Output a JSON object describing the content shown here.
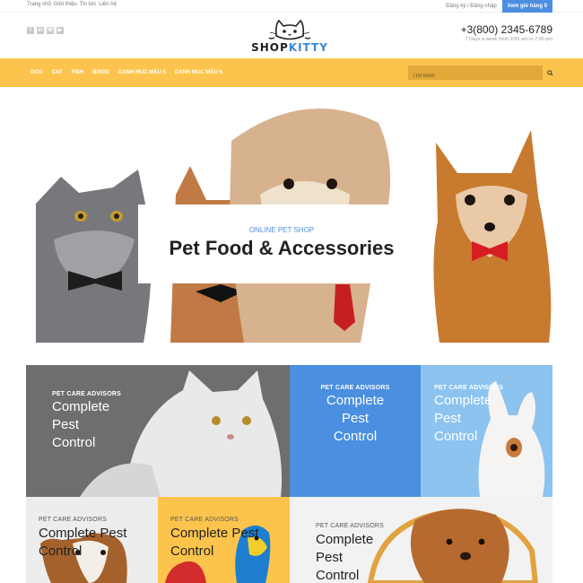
{
  "topbar": {
    "nav": [
      "Trang chủ",
      "Giới thiệu",
      "Tin tức",
      "Liên hệ"
    ],
    "auth": "Đăng ký / Đăng nhập",
    "cart": "Xem giỏ hàng 0"
  },
  "header": {
    "social_icons": [
      "facebook-icon",
      "linkedin-icon",
      "whatsapp-icon",
      "youtube-icon"
    ],
    "logo": {
      "text_a": "SHOP",
      "text_b": "KITTY"
    },
    "phone": "+3(800) 2345-6789",
    "hours": "7 Days a week from 9:00 am to 7:00 pm"
  },
  "nav": {
    "items": [
      "DOG",
      "CAT",
      "FISH",
      "BIRDS",
      "DANH MỤC MẪU 5",
      "DANH MỤC MẪU 6"
    ],
    "search_placeholder": "Tìm kiếm"
  },
  "hero": {
    "subtitle": "ONLINE PET SHOP",
    "title": "Pet Food & Accessories"
  },
  "tiles": [
    {
      "kicker": "PET CARE ADVISORS",
      "title_lines": [
        "Complete",
        "Pest",
        "Control"
      ]
    },
    {
      "kicker": "PET CARE ADVISORS",
      "title_lines": [
        "Complete",
        "Pest",
        "Control"
      ]
    },
    {
      "kicker": "PET CARE ADVISORS",
      "title_lines": [
        "Complete",
        "Pest",
        "Control"
      ]
    },
    {
      "kicker": "PET CARE ADVISORS",
      "title_lines": [
        "Complete Pest",
        "Control"
      ]
    },
    {
      "kicker": "PET CARE ADVISORS",
      "title_lines": [
        "Complete Pest",
        "Control"
      ]
    },
    {
      "kicker": "PET CARE ADVISORS",
      "title_lines": [
        "Complete",
        "Pest",
        "Control"
      ]
    }
  ],
  "colors": {
    "accent_yellow": "#fdc44d",
    "accent_blue": "#4a8fe0",
    "tile_blue": "#4a8fe0",
    "tile_lightblue": "#8cc3ef",
    "tile_gray": "#6e6e6e",
    "tile_yellow": "#fdc44d"
  }
}
